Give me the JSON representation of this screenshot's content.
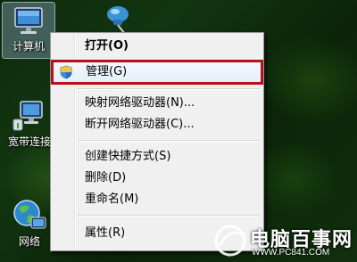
{
  "desktop": {
    "icons": [
      {
        "label": "计算机"
      },
      {
        "label": "宽带连接"
      },
      {
        "label": "网络"
      }
    ]
  },
  "context_menu": {
    "items": [
      {
        "label": "打开(O)",
        "bold": true
      },
      {
        "label": "管理(G)",
        "icon": "uac-shield-icon",
        "highlighted": true
      },
      {
        "label": "映射网络驱动器(N)..."
      },
      {
        "label": "断开网络驱动器(C)..."
      },
      {
        "label": "创建快捷方式(S)"
      },
      {
        "label": "删除(D)"
      },
      {
        "label": "重命名(M)"
      },
      {
        "label": "属性(R)"
      }
    ]
  },
  "annotation": {
    "color": "#b4111b"
  },
  "watermark": {
    "title": "电脑百事网",
    "url": "WWW.PC841.COM"
  }
}
